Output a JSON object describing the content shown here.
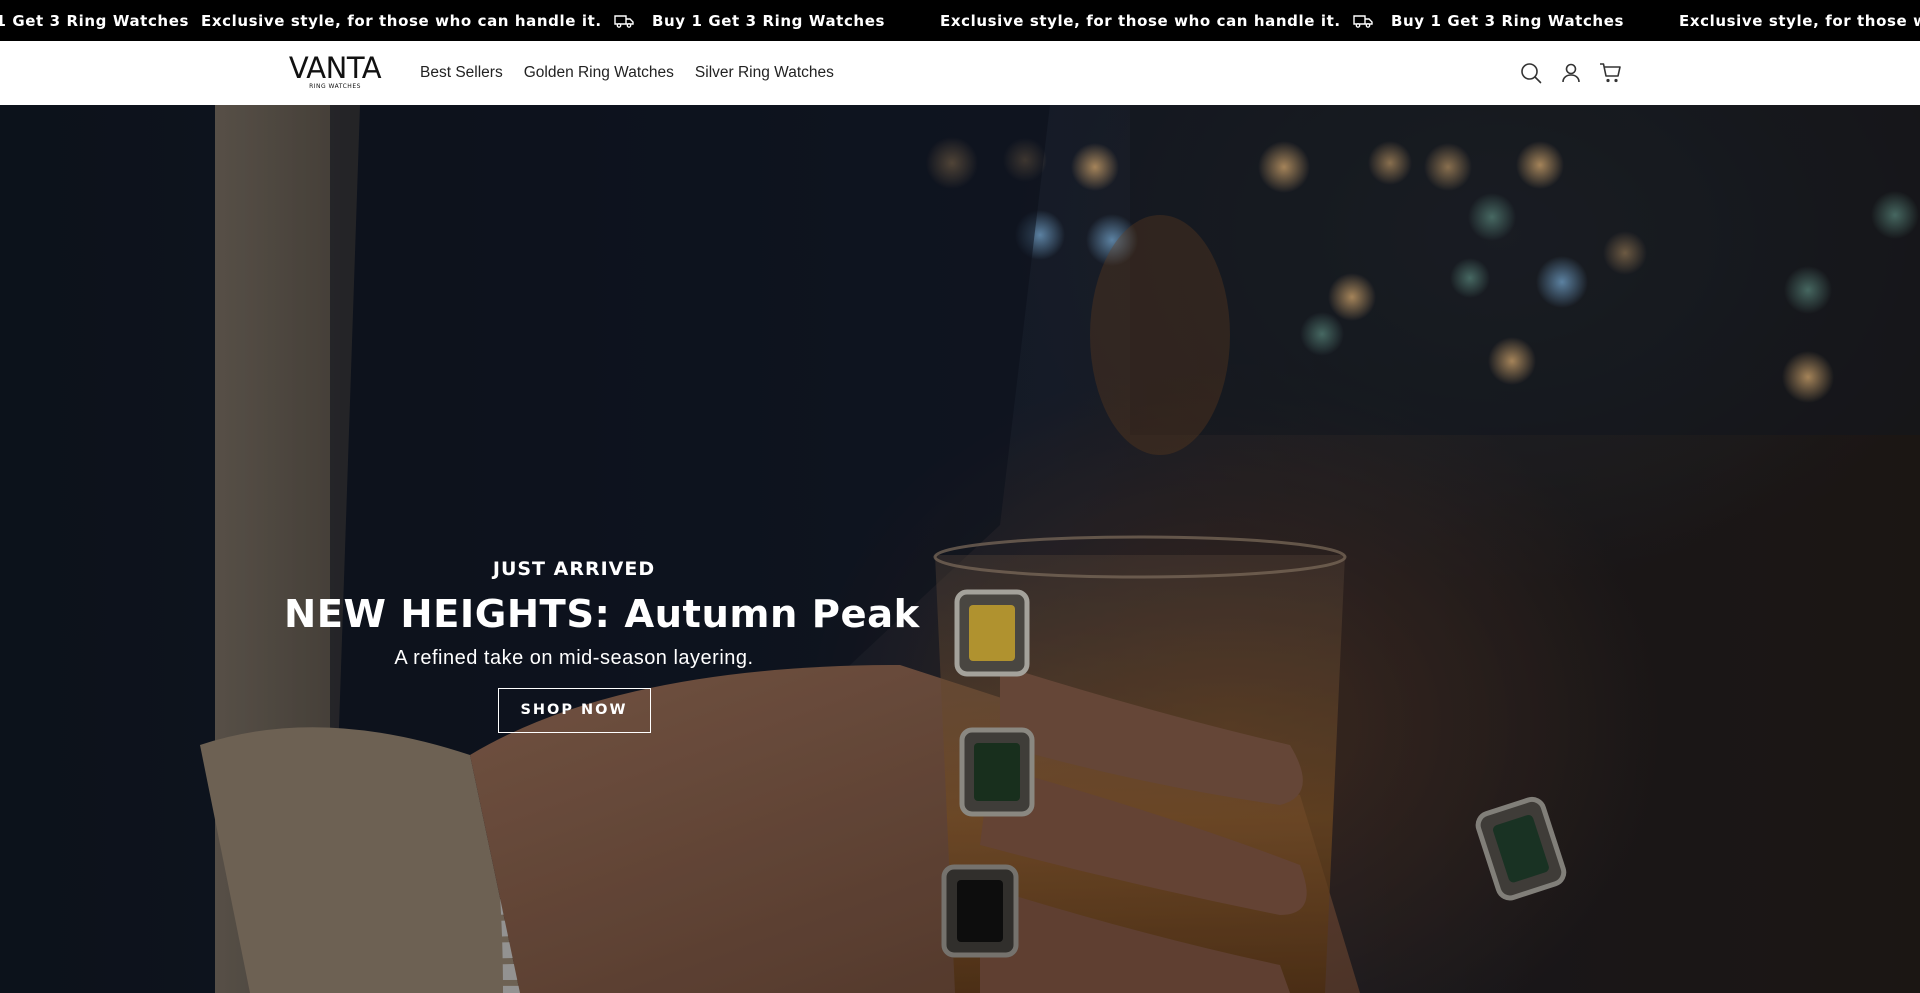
{
  "announcement": {
    "items": [
      {
        "text": "Buy 1 Get 3 Ring Watches",
        "icon": "truck-icon"
      },
      {
        "text": "Exclusive style, for those who can handle it.",
        "icon": null
      },
      {
        "text": "Buy 1 Get 3 Ring Watches",
        "icon": "truck-icon"
      },
      {
        "text": "Exclusive style, for those who can handle it.",
        "icon": null
      },
      {
        "text": "Buy 1 Get 3 Ring Watches",
        "icon": "truck-icon"
      },
      {
        "text": "Exclusive style, for those who can handle it.",
        "icon": null
      }
    ]
  },
  "header": {
    "logo": {
      "main": "VANTA",
      "sub": "RING WATCHES"
    },
    "nav": [
      "Best Sellers",
      "Golden Ring Watches",
      "Silver Ring Watches"
    ],
    "icons": [
      "search-icon",
      "account-icon",
      "cart-icon"
    ]
  },
  "hero": {
    "eyebrow": "JUST ARRIVED",
    "headline": "NEW HEIGHTS: Autumn Peak",
    "subline": "A refined take on mid-season layering.",
    "cta": "SHOP NOW"
  },
  "colors": {
    "announcement_bg": "#000000",
    "header_bg": "#ffffff",
    "text_light": "#ffffff",
    "text_dark": "#222222"
  }
}
